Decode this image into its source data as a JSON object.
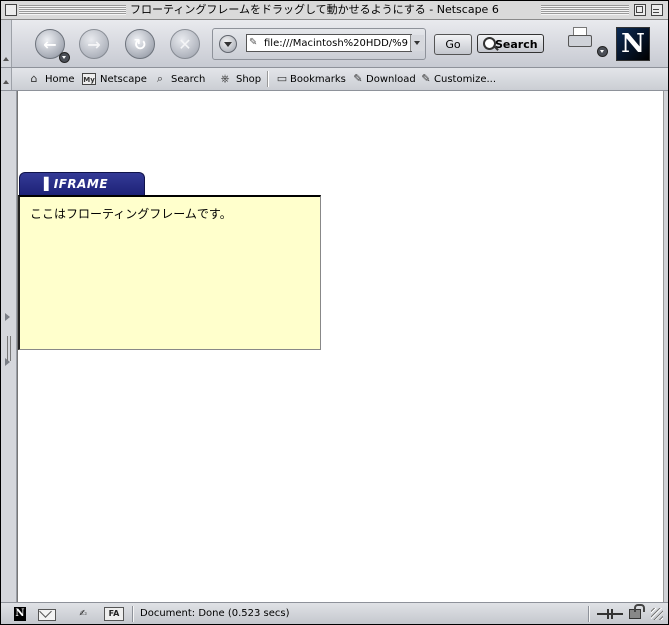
{
  "window": {
    "title": "フローティングフレームをドラッグして動かせるようにする - Netscape 6"
  },
  "navbar": {
    "back_icon": "back-arrow-icon",
    "forward_icon": "forward-arrow-icon",
    "reload_icon": "reload-icon",
    "stop_icon": "stop-icon",
    "url": "file:///Macintosh%20HDD/%9",
    "go_label": "Go",
    "search_label": "Search",
    "logo_letter": "N"
  },
  "personal_toolbar": {
    "items": [
      {
        "label": "Home",
        "icon": "home-icon"
      },
      {
        "label": "Netscape",
        "icon": "my-netscape-icon",
        "icon_text": "My"
      },
      {
        "label": "Search",
        "icon": "search-icon"
      },
      {
        "label": "Shop",
        "icon": "shop-icon"
      },
      {
        "label": "Bookmarks",
        "icon": "folder-icon"
      },
      {
        "label": "Download",
        "icon": "bookmark-icon"
      },
      {
        "label": "Customize...",
        "icon": "bookmark-icon"
      }
    ]
  },
  "content": {
    "frame": {
      "tab_label": "IFRAME",
      "text": "ここはフローティングフレームです。",
      "background": "#ffffcc",
      "tab_color": "#2a2f8a"
    }
  },
  "statusbar": {
    "composer_label": "FA",
    "status_text": "Document: Done (0.523 secs)"
  }
}
